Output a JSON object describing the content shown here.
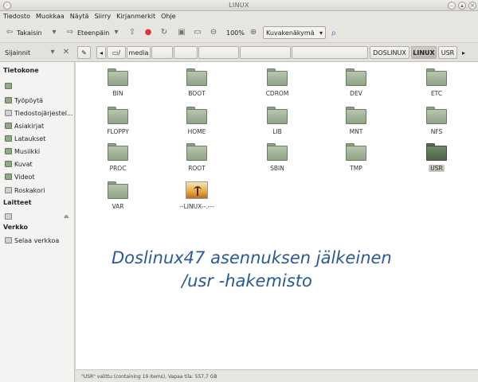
{
  "window": {
    "title": "LINUX"
  },
  "menu": [
    "Tiedosto",
    "Muokkaa",
    "Näytä",
    "Siirry",
    "Kirjanmerkit",
    "Ohje"
  ],
  "toolbar": {
    "back_label": "Takaisin",
    "forward_label": "Eteenpäin",
    "zoom": "100%",
    "view_mode": "Kuvakenäkymä"
  },
  "places": {
    "label": "Sijainnit"
  },
  "path": {
    "root": "/",
    "crumbs": [
      "media",
      "",
      "",
      "",
      "",
      "",
      "DOSLINUX",
      "LINUX",
      "USR"
    ],
    "active": "LINUX"
  },
  "sidebar": {
    "computer_header": "Tietokone",
    "computer_items": [
      "",
      "Työpöytä",
      "Tiedostojärjestel...",
      "Asiakirjat",
      "Lataukset",
      "Musiikki",
      "Kuvat",
      "Videot",
      "Roskakori"
    ],
    "devices_header": "Laitteet",
    "network_header": "Verkko",
    "network_items": [
      "Selaa verkkoa"
    ]
  },
  "files": [
    {
      "name": "BIN",
      "type": "folder"
    },
    {
      "name": "BOOT",
      "type": "folder"
    },
    {
      "name": "CDROM",
      "type": "folder"
    },
    {
      "name": "DEV",
      "type": "folder"
    },
    {
      "name": "ETC",
      "type": "folder"
    },
    {
      "name": "FLOPPY",
      "type": "folder"
    },
    {
      "name": "HOME",
      "type": "folder"
    },
    {
      "name": "LIB",
      "type": "folder"
    },
    {
      "name": "MNT",
      "type": "folder"
    },
    {
      "name": "NFS",
      "type": "folder"
    },
    {
      "name": "PROC",
      "type": "folder"
    },
    {
      "name": "ROOT",
      "type": "folder"
    },
    {
      "name": "SBIN",
      "type": "folder"
    },
    {
      "name": "TMP",
      "type": "folder"
    },
    {
      "name": "USR",
      "type": "folder",
      "selected": true
    },
    {
      "name": "VAR",
      "type": "folder"
    },
    {
      "name": "--LINUX--.---",
      "type": "image"
    }
  ],
  "caption": {
    "line1": "Doslinux47 asennuksen jälkeinen",
    "line2": "/usr -hakemisto"
  },
  "status": "\"USR\" valittu (containing 19 items), Vapaa tila: 557,7 GB",
  "colors": {
    "folder": "#8fa386",
    "folder_selected": "#4f6546",
    "caption": "#2a5a93"
  }
}
